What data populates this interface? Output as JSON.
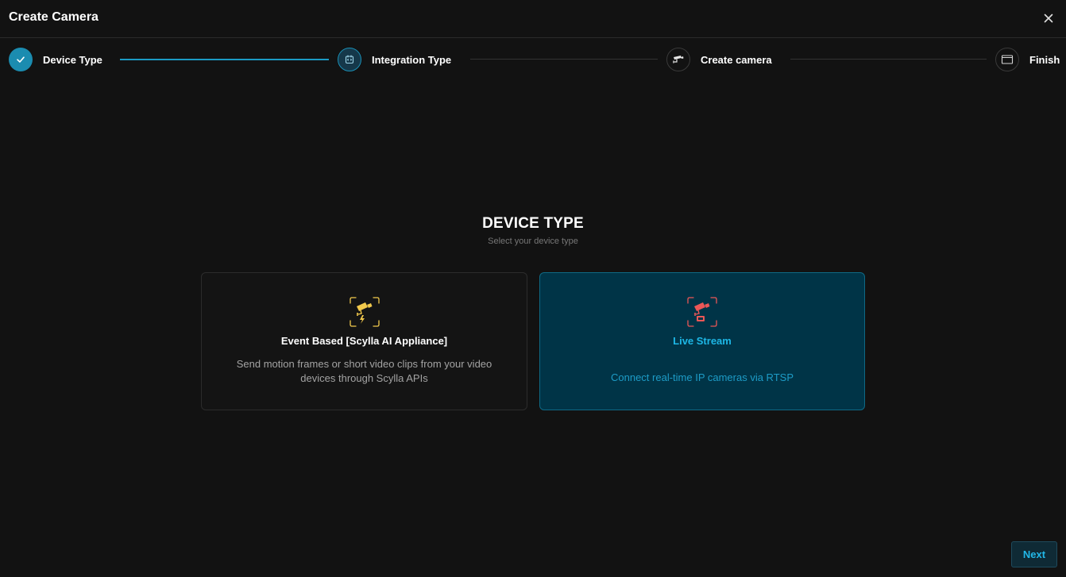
{
  "dialog": {
    "title": "Create Camera"
  },
  "stepper": {
    "steps": [
      {
        "label": "Device Type",
        "state": "done",
        "icon": "check-icon"
      },
      {
        "label": "Integration Type",
        "state": "active",
        "icon": "integration-icon"
      },
      {
        "label": "Create camera",
        "state": "pending",
        "icon": "cctv-camera-icon"
      },
      {
        "label": "Finish",
        "state": "pending",
        "icon": "film-frame-icon"
      }
    ]
  },
  "section": {
    "title": "DEVICE TYPE",
    "subtitle": "Select your device type"
  },
  "options": [
    {
      "title": "Event Based [Scylla AI Appliance]",
      "description": "Send motion frames or short video clips from your video devices through Scylla APIs",
      "icon": "event-camera-icon",
      "selected": false
    },
    {
      "title": "Live Stream",
      "description": "Connect real-time IP cameras via RTSP",
      "icon": "live-camera-icon",
      "selected": true
    }
  ],
  "footer": {
    "next_label": "Next"
  },
  "colors": {
    "background": "#121212",
    "accent": "#1db7e6",
    "selected_card": "#003447",
    "event_icon": "#f2c94c",
    "live_icon": "#eb5757"
  }
}
